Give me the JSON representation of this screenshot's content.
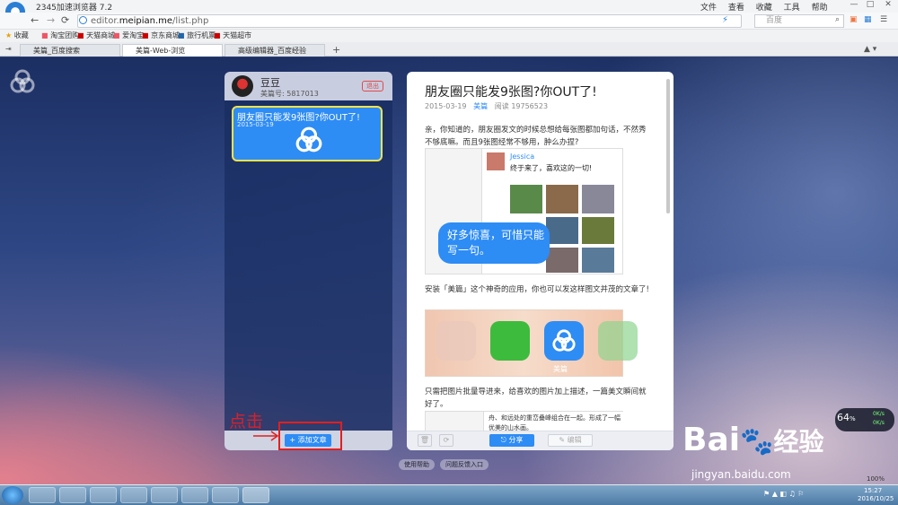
{
  "browser": {
    "title": "2345加速浏览器 7.2",
    "url_prefix": "editor.",
    "url_domain": "meipian.me",
    "url_path": "/list.php",
    "search_placeholder": "百度",
    "menu": [
      "文件",
      "查看",
      "收藏",
      "工具",
      "帮助"
    ],
    "favorites_label": "收藏",
    "bookmarks": [
      "淘宝团购",
      "天猫商城",
      "爱淘宝",
      "京东商城",
      "旅行机票",
      "天猫超市"
    ],
    "tabs": [
      {
        "label": "美篇_百度搜索"
      },
      {
        "label": "美篇-Web-浏览"
      },
      {
        "label": "高级编辑器_百度经验"
      }
    ],
    "new_tab": "+",
    "zoom": "100%"
  },
  "left_panel": {
    "username": "豆豆",
    "user_id": "美篇号: 5817013",
    "logout": "退出",
    "card_title": "朋友圈只能发9张图?你OUT了!",
    "card_date": "2015-03-19",
    "add_article": "+ 添加文章"
  },
  "annotation": {
    "click_hint": "点击"
  },
  "article": {
    "title": "朋友圈只能发9张图?你OUT了!",
    "date": "2015-03-19",
    "author": "美篇",
    "reads": "阅读 19756523",
    "p1": "亲，你知道的，朋友圈发文的时候总想给每张图都加句话，不然秀不够底嘛。而且9张图经常不够用，肿么办捏?",
    "img1_name": "Jessica",
    "img1_caption": "终于来了，喜欢这的一切!",
    "img1_bubble": "好多惊喜，可惜只能写一句。",
    "p2": "安装「美篇」这个神奇的应用，你也可以发这样图文并茂的文章了!",
    "img2_label": "美篇",
    "p3": "只需把图片批量导进来，给喜欢的图片加上描述，一篇美文瞬间就好了。",
    "img3_text": "舟、和远处的重峦叠峰组合在一起。形成了一幅优美的山水画。",
    "share": "分享",
    "edit": "编辑"
  },
  "bottom_links": [
    "使用帮助",
    "问题反馈入口"
  ],
  "widgets": {
    "perf_value": "64",
    "perf_unit": "%",
    "perf_up": "0K/s",
    "perf_down": "0K/s",
    "watermark": "Bai",
    "watermark_suffix": "经验",
    "watermark_url": "jingyan.baidu.com"
  },
  "taskbar": {
    "time": "15:27",
    "date": "2016/10/25"
  },
  "colors": {
    "accent": "#2e8cf5",
    "highlight_border": "#f5e44a",
    "annotation_red": "#e02020"
  }
}
